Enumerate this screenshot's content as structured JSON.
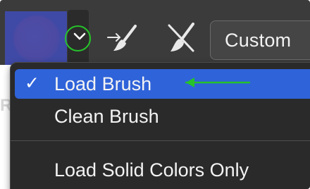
{
  "toolbar": {
    "custom_label": "Custom"
  },
  "side": {
    "letter": "R"
  },
  "menu": {
    "items": [
      {
        "label": "Load Brush",
        "selected": true,
        "checkmark": "✓"
      },
      {
        "label": "Clean Brush",
        "selected": false
      },
      {
        "label": "Load Solid Colors Only",
        "selected": false
      }
    ]
  },
  "icons": {
    "dropdown": "chevron-down-icon",
    "load_brush_tool": "paint-brush-load-icon",
    "clean_brush_tool": "paint-brush-clean-icon"
  },
  "colors": {
    "menu_selected": "#2f63d9",
    "highlight_ring": "#26c22a",
    "arrow": "#26c22a"
  }
}
